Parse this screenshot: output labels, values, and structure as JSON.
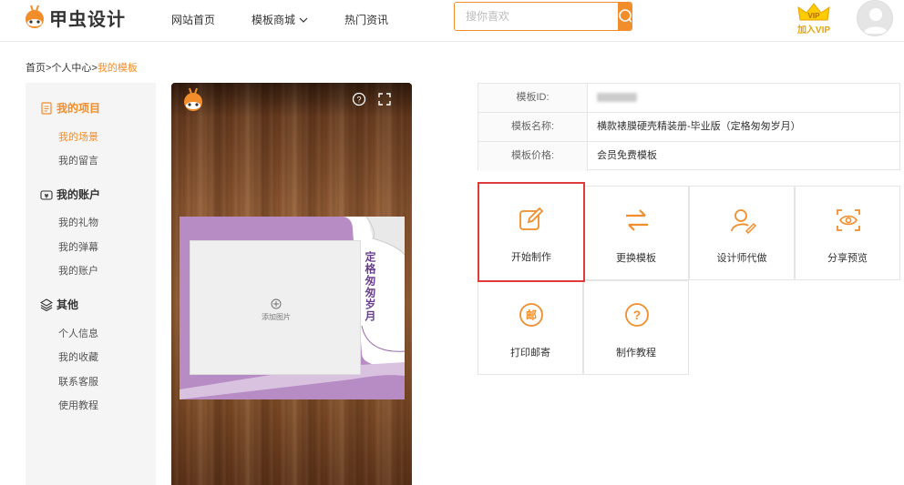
{
  "header": {
    "logo_text": "甲虫设计",
    "nav": [
      "网站首页",
      "模板商城",
      "热门资讯"
    ],
    "search_placeholder": "搜你喜欢",
    "vip_label": "加入VIP",
    "colors": {
      "accent": "#f18d2b",
      "highlight": "#e03a3a"
    }
  },
  "breadcrumb": {
    "home": "首页",
    "sep1": ">",
    "center": "个人中心",
    "sep2": ">",
    "current": "我的模板"
  },
  "sidebar": {
    "groups": [
      {
        "label": "我的项目",
        "icon": "document-icon",
        "items": [
          "我的场景",
          "我的留言"
        ]
      },
      {
        "label": "我的账户",
        "icon": "yen-wallet-icon",
        "items": [
          "我的礼物",
          "我的弹幕",
          "我的账户"
        ]
      },
      {
        "label": "其他",
        "icon": "layers-icon",
        "items": [
          "个人信息",
          "我的收藏",
          "联系客服",
          "使用教程"
        ]
      }
    ]
  },
  "preview": {
    "help": "?",
    "photo_placeholder": "添加图片",
    "album_title": "定格匆匆岁月"
  },
  "info": {
    "rows": [
      {
        "label": "模板ID:",
        "value": ""
      },
      {
        "label": "模板名称:",
        "value": "横款裱膜硬壳精装册-毕业版（定格匆匆岁月）"
      },
      {
        "label": "模板价格:",
        "value": "会员免费模板"
      }
    ]
  },
  "actions": [
    {
      "label": "开始制作",
      "icon": "edit-icon"
    },
    {
      "label": "更换模板",
      "icon": "swap-icon"
    },
    {
      "label": "设计师代做",
      "icon": "designer-icon"
    },
    {
      "label": "分享预览",
      "icon": "eye-scan-icon"
    },
    {
      "label": "打印邮寄",
      "icon": "mail-icon"
    },
    {
      "label": "制作教程",
      "icon": "question-icon"
    }
  ]
}
